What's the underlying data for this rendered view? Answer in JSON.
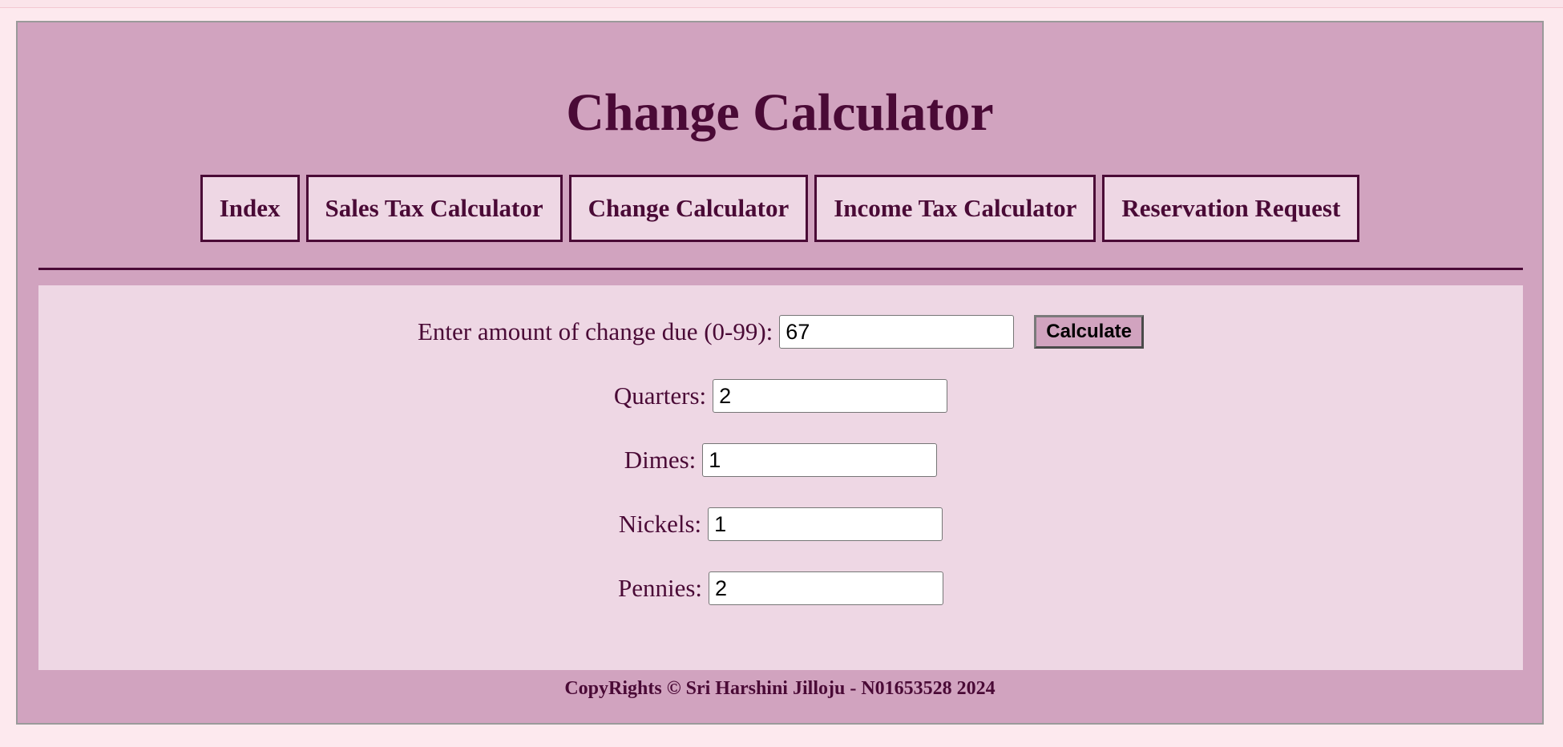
{
  "header": {
    "title": "Change Calculator"
  },
  "nav": {
    "items": [
      {
        "label": "Index"
      },
      {
        "label": "Sales Tax Calculator"
      },
      {
        "label": "Change Calculator"
      },
      {
        "label": "Income Tax Calculator"
      },
      {
        "label": "Reservation Request"
      }
    ]
  },
  "form": {
    "amount_label": "Enter amount of change due (0-99):",
    "amount_value": "67",
    "calculate_label": "Calculate",
    "quarters_label": "Quarters:",
    "quarters_value": "2",
    "dimes_label": "Dimes:",
    "dimes_value": "1",
    "nickels_label": "Nickels:",
    "nickels_value": "1",
    "pennies_label": "Pennies:",
    "pennies_value": "2"
  },
  "footer": {
    "text": "CopyRights © Sri Harshini Jilloju - N01653528 2024"
  },
  "colors": {
    "frame_bg": "#d1a3bf",
    "panel_bg": "#eed7e4",
    "accent": "#4a0a36",
    "page_bg": "#fde9ee"
  }
}
